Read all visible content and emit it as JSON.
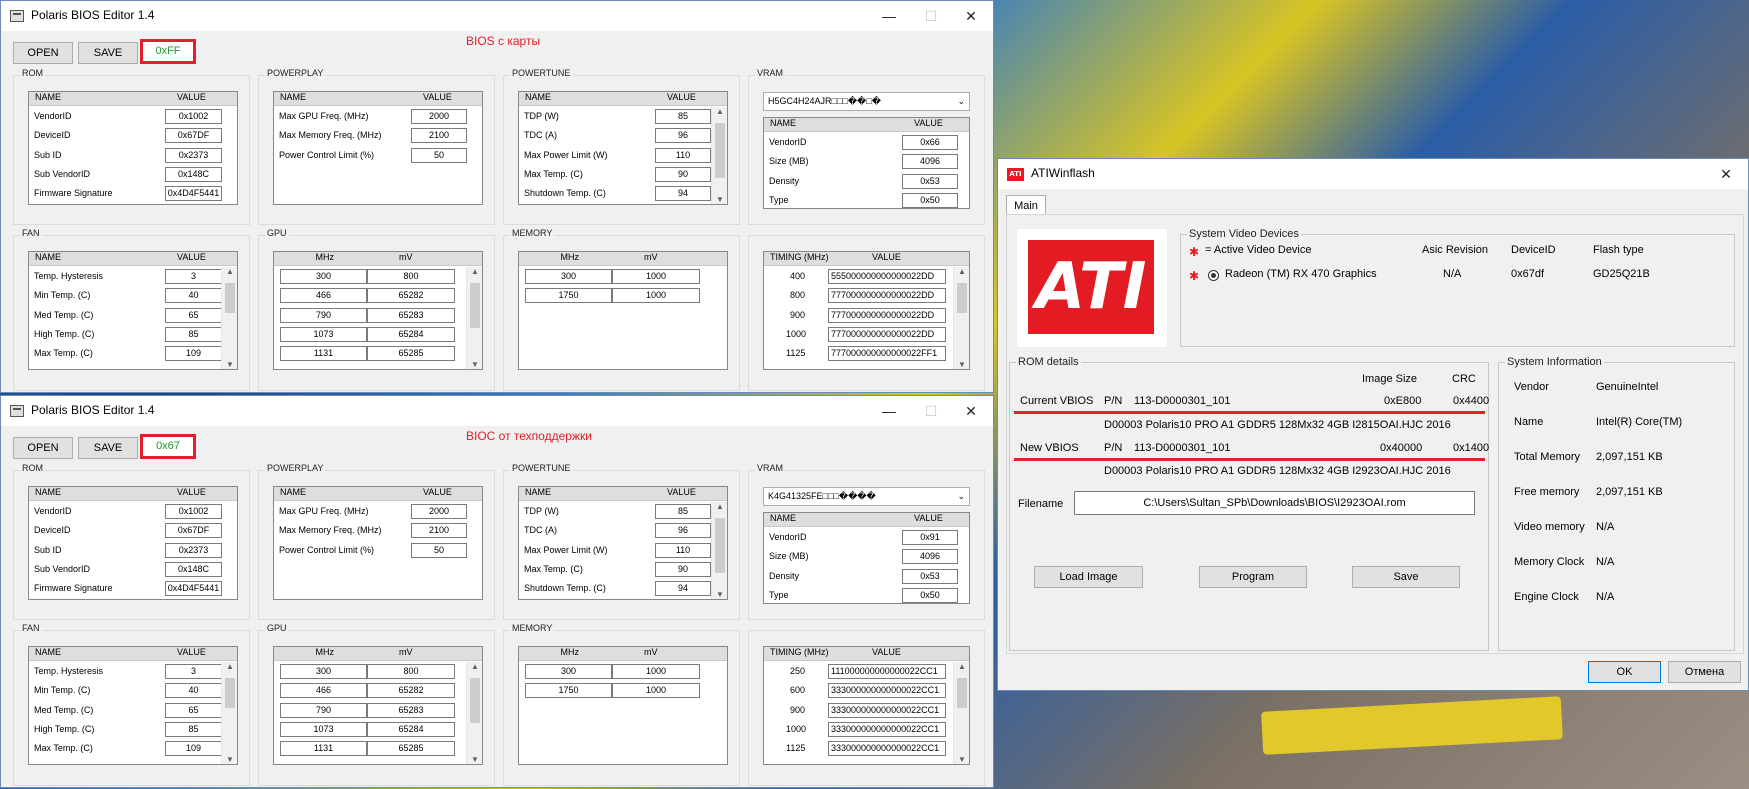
{
  "bios_editor_1": {
    "title": "Polaris BIOS Editor 1.4",
    "open_label": "OPEN",
    "save_label": "SAVE",
    "checksum": "0xFF",
    "caption": "BIOS с карты",
    "groups": {
      "rom": "ROM",
      "powerplay": "POWERPLAY",
      "powertune": "POWERTUNE",
      "vram": "VRAM",
      "fan": "FAN",
      "gpu": "GPU",
      "memory": "MEMORY"
    },
    "headers": {
      "name": "NAME",
      "value": "VALUE",
      "mhz": "MHz",
      "mv": "mV",
      "timing": "TIMING (MHz)"
    },
    "rom": [
      {
        "name": "VendorID",
        "value": "0x1002"
      },
      {
        "name": "DeviceID",
        "value": "0x67DF"
      },
      {
        "name": "Sub ID",
        "value": "0x2373"
      },
      {
        "name": "Sub VendorID",
        "value": "0x148C"
      },
      {
        "name": "Firmware Signature",
        "value": "0x4D4F5441"
      }
    ],
    "powerplay": [
      {
        "name": "Max GPU Freq. (MHz)",
        "value": "2000"
      },
      {
        "name": "Max Memory Freq. (MHz)",
        "value": "2100"
      },
      {
        "name": "Power Control Limit (%)",
        "value": "50"
      }
    ],
    "powertune": [
      {
        "name": "TDP (W)",
        "value": "85"
      },
      {
        "name": "TDC (A)",
        "value": "96"
      },
      {
        "name": "Max Power Limit (W)",
        "value": "110"
      },
      {
        "name": "Max Temp. (C)",
        "value": "90"
      },
      {
        "name": "Shutdown Temp. (C)",
        "value": "94"
      }
    ],
    "vram_selected": "H5GC4H24AJR□□□��□�",
    "vram": [
      {
        "name": "VendorID",
        "value": "0x66"
      },
      {
        "name": "Size (MB)",
        "value": "4096"
      },
      {
        "name": "Density",
        "value": "0x53"
      },
      {
        "name": "Type",
        "value": "0x50"
      }
    ],
    "fan": [
      {
        "name": "Temp. Hysteresis",
        "value": "3"
      },
      {
        "name": "Min Temp. (C)",
        "value": "40"
      },
      {
        "name": "Med Temp. (C)",
        "value": "65"
      },
      {
        "name": "High Temp. (C)",
        "value": "85"
      },
      {
        "name": "Max Temp. (C)",
        "value": "109"
      }
    ],
    "gpu": [
      {
        "mhz": "300",
        "mv": "800"
      },
      {
        "mhz": "466",
        "mv": "65282"
      },
      {
        "mhz": "790",
        "mv": "65283"
      },
      {
        "mhz": "1073",
        "mv": "65284"
      },
      {
        "mhz": "1131",
        "mv": "65285"
      }
    ],
    "memory": [
      {
        "mhz": "300",
        "mv": "1000"
      },
      {
        "mhz": "1750",
        "mv": "1000"
      }
    ],
    "timing": [
      {
        "mhz": "400",
        "value": "555000000000000022DD"
      },
      {
        "mhz": "800",
        "value": "777000000000000022DD"
      },
      {
        "mhz": "900",
        "value": "777000000000000022DD"
      },
      {
        "mhz": "1000",
        "value": "777000000000000022DD"
      },
      {
        "mhz": "1125",
        "value": "777000000000000022FF1"
      }
    ]
  },
  "bios_editor_2": {
    "title": "Polaris BIOS Editor 1.4",
    "open_label": "OPEN",
    "save_label": "SAVE",
    "checksum": "0x67",
    "caption": "BIOC от техподдержки",
    "groups": {
      "rom": "ROM",
      "powerplay": "POWERPLAY",
      "powertune": "POWERTUNE",
      "vram": "VRAM",
      "fan": "FAN",
      "gpu": "GPU",
      "memory": "MEMORY"
    },
    "headers": {
      "name": "NAME",
      "value": "VALUE",
      "mhz": "MHz",
      "mv": "mV",
      "timing": "TIMING (MHz)"
    },
    "rom": [
      {
        "name": "VendorID",
        "value": "0x1002"
      },
      {
        "name": "DeviceID",
        "value": "0x67DF"
      },
      {
        "name": "Sub ID",
        "value": "0x2373"
      },
      {
        "name": "Sub VendorID",
        "value": "0x148C"
      },
      {
        "name": "Firmware Signature",
        "value": "0x4D4F5441"
      }
    ],
    "powerplay": [
      {
        "name": "Max GPU Freq. (MHz)",
        "value": "2000"
      },
      {
        "name": "Max Memory Freq. (MHz)",
        "value": "2100"
      },
      {
        "name": "Power Control Limit (%)",
        "value": "50"
      }
    ],
    "powertune": [
      {
        "name": "TDP (W)",
        "value": "85"
      },
      {
        "name": "TDC (A)",
        "value": "96"
      },
      {
        "name": "Max Power Limit (W)",
        "value": "110"
      },
      {
        "name": "Max Temp. (C)",
        "value": "90"
      },
      {
        "name": "Shutdown Temp. (C)",
        "value": "94"
      }
    ],
    "vram_selected": "K4G41325FE□□□����",
    "vram": [
      {
        "name": "VendorID",
        "value": "0x91"
      },
      {
        "name": "Size (MB)",
        "value": "4096"
      },
      {
        "name": "Density",
        "value": "0x53"
      },
      {
        "name": "Type",
        "value": "0x50"
      }
    ],
    "fan": [
      {
        "name": "Temp. Hysteresis",
        "value": "3"
      },
      {
        "name": "Min Temp. (C)",
        "value": "40"
      },
      {
        "name": "Med Temp. (C)",
        "value": "65"
      },
      {
        "name": "High Temp. (C)",
        "value": "85"
      },
      {
        "name": "Max Temp. (C)",
        "value": "109"
      }
    ],
    "gpu": [
      {
        "mhz": "300",
        "mv": "800"
      },
      {
        "mhz": "466",
        "mv": "65282"
      },
      {
        "mhz": "790",
        "mv": "65283"
      },
      {
        "mhz": "1073",
        "mv": "65284"
      },
      {
        "mhz": "1131",
        "mv": "65285"
      }
    ],
    "memory": [
      {
        "mhz": "300",
        "mv": "1000"
      },
      {
        "mhz": "1750",
        "mv": "1000"
      }
    ],
    "timing": [
      {
        "mhz": "250",
        "value": "111000000000000022CC1"
      },
      {
        "mhz": "600",
        "value": "333000000000000022CC1"
      },
      {
        "mhz": "900",
        "value": "333000000000000022CC1"
      },
      {
        "mhz": "1000",
        "value": "333000000000000022CC1"
      },
      {
        "mhz": "1125",
        "value": "333000000000000022CC1"
      }
    ]
  },
  "atiwinflash": {
    "title": "ATIWinflash",
    "logo_text": "ATI",
    "tab_main": "Main",
    "devices": {
      "label": "System Video Devices",
      "active_legend": "= Active Video Device",
      "col_asic": "Asic Revision",
      "col_deviceid": "DeviceID",
      "col_flash": "Flash type",
      "device_name": "Radeon (TM) RX 470 Graphics",
      "asic": "N/A",
      "deviceid": "0x67df",
      "flash": "GD25Q21B"
    },
    "rom": {
      "label": "ROM details",
      "col_size": "Image Size",
      "col_crc": "CRC",
      "current_label": "Current VBIOS",
      "current_pn_label": "P/N",
      "current_pn": "113-D0000301_101",
      "current_size": "0xE800",
      "current_crc": "0x4400",
      "current_desc": "D00003 Polaris10 PRO A1 GDDR5 128Mx32 4GB I2815OAI.HJC 2016",
      "new_label": "New VBIOS",
      "new_pn_label": "P/N",
      "new_pn": "113-D0000301_101",
      "new_size": "0x40000",
      "new_crc": "0x1400",
      "new_desc": "D00003 Polaris10 PRO A1 GDDR5 128Mx32 4GB I2923OAI.HJC 2016",
      "filename_label": "Filename",
      "filename": "C:\\Users\\Sultan_SPb\\Downloads\\BIOS\\I2923OAI.rom",
      "load_label": "Load Image",
      "program_label": "Program",
      "save_label": "Save"
    },
    "sysinfo": {
      "label": "System Information",
      "rows": [
        {
          "name": "Vendor",
          "value": "GenuineIntel"
        },
        {
          "name": "Name",
          "value": "Intel(R) Core(TM)"
        },
        {
          "name": "Total Memory",
          "value": "2,097,151 KB"
        },
        {
          "name": "Free memory",
          "value": "2,097,151 KB"
        },
        {
          "name": "Video memory",
          "value": "N/A"
        },
        {
          "name": "Memory Clock",
          "value": "N/A"
        },
        {
          "name": "Engine Clock",
          "value": "N/A"
        }
      ]
    },
    "ok_label": "OK",
    "cancel_label": "Отмена"
  }
}
